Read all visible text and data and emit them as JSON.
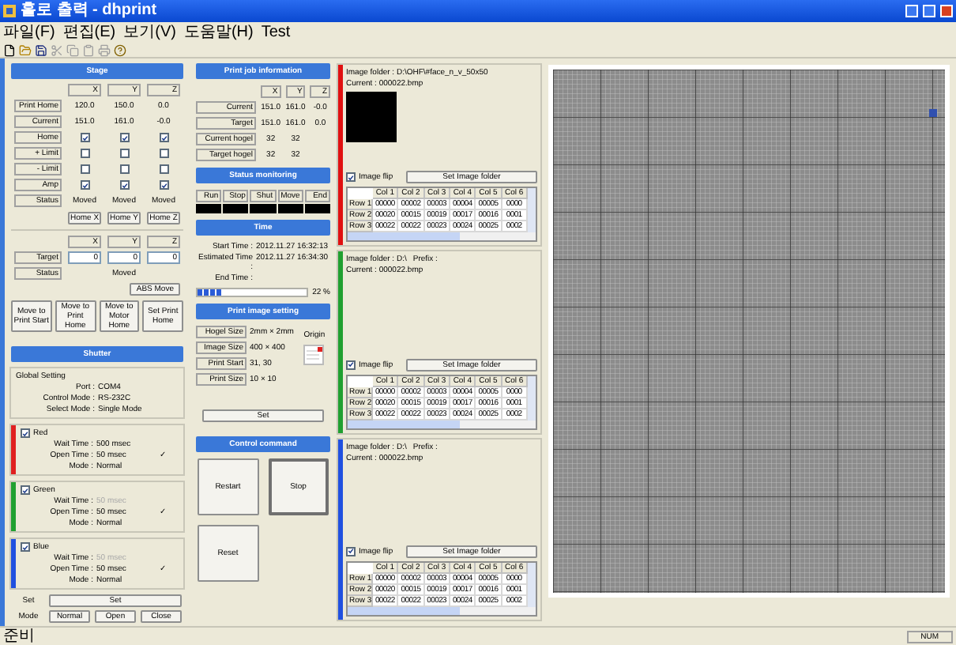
{
  "window": {
    "title": "홀로 출력 - dhprint"
  },
  "menu": [
    "파일(F)",
    "편집(E)",
    "보기(V)",
    "도움말(H)",
    "Test"
  ],
  "status_bar": {
    "text": "준비",
    "indicator": "NUM"
  },
  "stage": {
    "header": "Stage",
    "columns": [
      "X",
      "Y",
      "Z"
    ],
    "rows": [
      {
        "kind": "text",
        "label": "Print Home",
        "values": [
          "120.0",
          "150.0",
          "0.0"
        ]
      },
      {
        "kind": "text",
        "label": "Current",
        "values": [
          "151.0",
          "161.0",
          "-0.0"
        ]
      },
      {
        "kind": "check",
        "label": "Home",
        "checked": [
          true,
          true,
          true
        ]
      },
      {
        "kind": "check",
        "label": "+ Limit",
        "checked": [
          false,
          false,
          false
        ]
      },
      {
        "kind": "check",
        "label": "- Limit",
        "checked": [
          false,
          false,
          false
        ]
      },
      {
        "kind": "check",
        "label": "Amp",
        "checked": [
          true,
          true,
          true
        ]
      },
      {
        "kind": "text",
        "label": "Status",
        "values": [
          "Moved",
          "Moved",
          "Moved"
        ]
      }
    ],
    "home_buttons": [
      "Home X",
      "Home Y",
      "Home Z"
    ],
    "move": {
      "columns": [
        "X",
        "Y",
        "Z"
      ],
      "target_label": "Target",
      "targets": [
        "0",
        "0",
        "0"
      ],
      "status_label": "Status",
      "status": "Moved",
      "abs_button": "ABS Move"
    },
    "move_buttons": [
      "Move to Print Start",
      "Move to Print Home",
      "Move to Motor Home",
      "Set Print Home"
    ]
  },
  "shutter": {
    "header": "Shutter",
    "global": {
      "title": "Global Setting",
      "rows": [
        {
          "label": "Port :",
          "value": "COM4"
        },
        {
          "label": "Control Mode :",
          "value": "RS-232C"
        },
        {
          "label": "Select Mode :",
          "value": "Single Mode"
        }
      ]
    },
    "channels": [
      {
        "name": "Red",
        "color": "#e02020",
        "checked": true,
        "mark": "✓",
        "rows": [
          {
            "label": "Wait Time :",
            "value": "500 msec",
            "disabled": false
          },
          {
            "label": "Open Time :",
            "value": "50 msec",
            "disabled": false
          },
          {
            "label": "Mode :",
            "value": "Normal",
            "disabled": false
          }
        ]
      },
      {
        "name": "Green",
        "color": "#20a030",
        "checked": true,
        "mark": "✓",
        "rows": [
          {
            "label": "Wait Time :",
            "value": "50 msec",
            "disabled": true
          },
          {
            "label": "Open Time :",
            "value": "50 msec",
            "disabled": false
          },
          {
            "label": "Mode :",
            "value": "Normal",
            "disabled": false
          }
        ]
      },
      {
        "name": "Blue",
        "color": "#2050e0",
        "checked": true,
        "mark": "✓",
        "rows": [
          {
            "label": "Wait Time :",
            "value": "50 msec",
            "disabled": true
          },
          {
            "label": "Open Time :",
            "value": "50 msec",
            "disabled": false
          },
          {
            "label": "Mode :",
            "value": "Normal",
            "disabled": false
          }
        ]
      }
    ],
    "set_label": "Set",
    "set_button": "Set",
    "mode_label": "Mode",
    "mode_buttons": [
      "Normal",
      "Open",
      "Close"
    ]
  },
  "job": {
    "header": "Print job information",
    "columns": [
      "X",
      "Y",
      "Z"
    ],
    "rows": [
      {
        "label": "Current",
        "values": [
          "151.0",
          "161.0",
          "-0.0"
        ]
      },
      {
        "label": "Target",
        "values": [
          "151.0",
          "161.0",
          "0.0"
        ]
      },
      {
        "label": "Current hogel",
        "values": [
          "32",
          "32"
        ]
      },
      {
        "label": "Target hogel",
        "values": [
          "32",
          "32"
        ]
      }
    ]
  },
  "monitor": {
    "header": "Status monitoring",
    "items": [
      {
        "label": "Run",
        "on": false
      },
      {
        "label": "Stop",
        "on": false
      },
      {
        "label": "Shut",
        "on": false
      },
      {
        "label": "Move",
        "on": false
      },
      {
        "label": "End",
        "on": false
      }
    ]
  },
  "time": {
    "header": "Time",
    "rows": [
      {
        "label": "Start Time :",
        "value": "2012.11.27 16:32:13"
      },
      {
        "label": "Estimated Time :",
        "value": "2012.11.27 16:34:30"
      },
      {
        "label": "End Time :",
        "value": ""
      }
    ],
    "level": 0.22,
    "percent": "22 %"
  },
  "image_setting": {
    "header": "Print image setting",
    "rows": [
      {
        "label": "Hogel Size",
        "value": "2mm × 2mm"
      },
      {
        "label": "Image Size",
        "value": "400 × 400"
      },
      {
        "label": "Print Start",
        "value": "31, 30"
      },
      {
        "label": "Print Size",
        "value": "10 × 10"
      }
    ],
    "origin_label": "Origin",
    "set_button": "Set"
  },
  "control": {
    "header": "Control command",
    "buttons": [
      "Restart",
      "Stop",
      "Reset"
    ]
  },
  "panels": [
    {
      "color": "#e01010",
      "folder": "Image folder : D:\\OHF\\#face_n_v_50x50",
      "current": "Current : 000022.bmp",
      "preview": true,
      "flip_label": "Image flip",
      "flip": true,
      "button": "Set Image folder",
      "table": {
        "columns": [
          "Col 1",
          "Col 2",
          "Col 3",
          "Col 4",
          "Col 5",
          "Col 6"
        ],
        "rows": [
          {
            "label": "Row 1",
            "cells": [
              "00000",
              "00002",
              "00003",
              "00004",
              "00005",
              "0000"
            ]
          },
          {
            "label": "Row 2",
            "cells": [
              "00020",
              "00015",
              "00019",
              "00017",
              "00016",
              "0001"
            ]
          },
          {
            "label": "Row 3",
            "cells": [
              "00022",
              "00022",
              "00023",
              "00024",
              "00025",
              "0002"
            ]
          }
        ]
      }
    },
    {
      "color": "#20a030",
      "folder": "Image folder : D:\\",
      "prefix": "Prefix :",
      "current": "Current : 000022.bmp",
      "preview": false,
      "flip_label": "Image flip",
      "flip": true,
      "button": "Set Image folder",
      "table": {
        "columns": [
          "Col 1",
          "Col 2",
          "Col 3",
          "Col 4",
          "Col 5",
          "Col 6"
        ],
        "rows": [
          {
            "label": "Row 1",
            "cells": [
              "00000",
              "00002",
              "00003",
              "00004",
              "00005",
              "0000"
            ]
          },
          {
            "label": "Row 2",
            "cells": [
              "00020",
              "00015",
              "00019",
              "00017",
              "00016",
              "0001"
            ]
          },
          {
            "label": "Row 3",
            "cells": [
              "00022",
              "00022",
              "00023",
              "00024",
              "00025",
              "0002"
            ]
          }
        ]
      }
    },
    {
      "color": "#2050e0",
      "folder": "Image folder : D:\\",
      "prefix": "Prefix :",
      "current": "Current : 000022.bmp",
      "preview": false,
      "flip_label": "Image flip",
      "flip": true,
      "button": "Set Image folder",
      "table": {
        "columns": [
          "Col 1",
          "Col 2",
          "Col 3",
          "Col 4",
          "Col 5",
          "Col 6"
        ],
        "rows": [
          {
            "label": "Row 1",
            "cells": [
              "00000",
              "00002",
              "00003",
              "00004",
              "00005",
              "0000"
            ]
          },
          {
            "label": "Row 2",
            "cells": [
              "00020",
              "00015",
              "00019",
              "00017",
              "00016",
              "0001"
            ]
          },
          {
            "label": "Row 3",
            "cells": [
              "00022",
              "00022",
              "00023",
              "00024",
              "00025",
              "0002"
            ]
          }
        ]
      }
    }
  ]
}
